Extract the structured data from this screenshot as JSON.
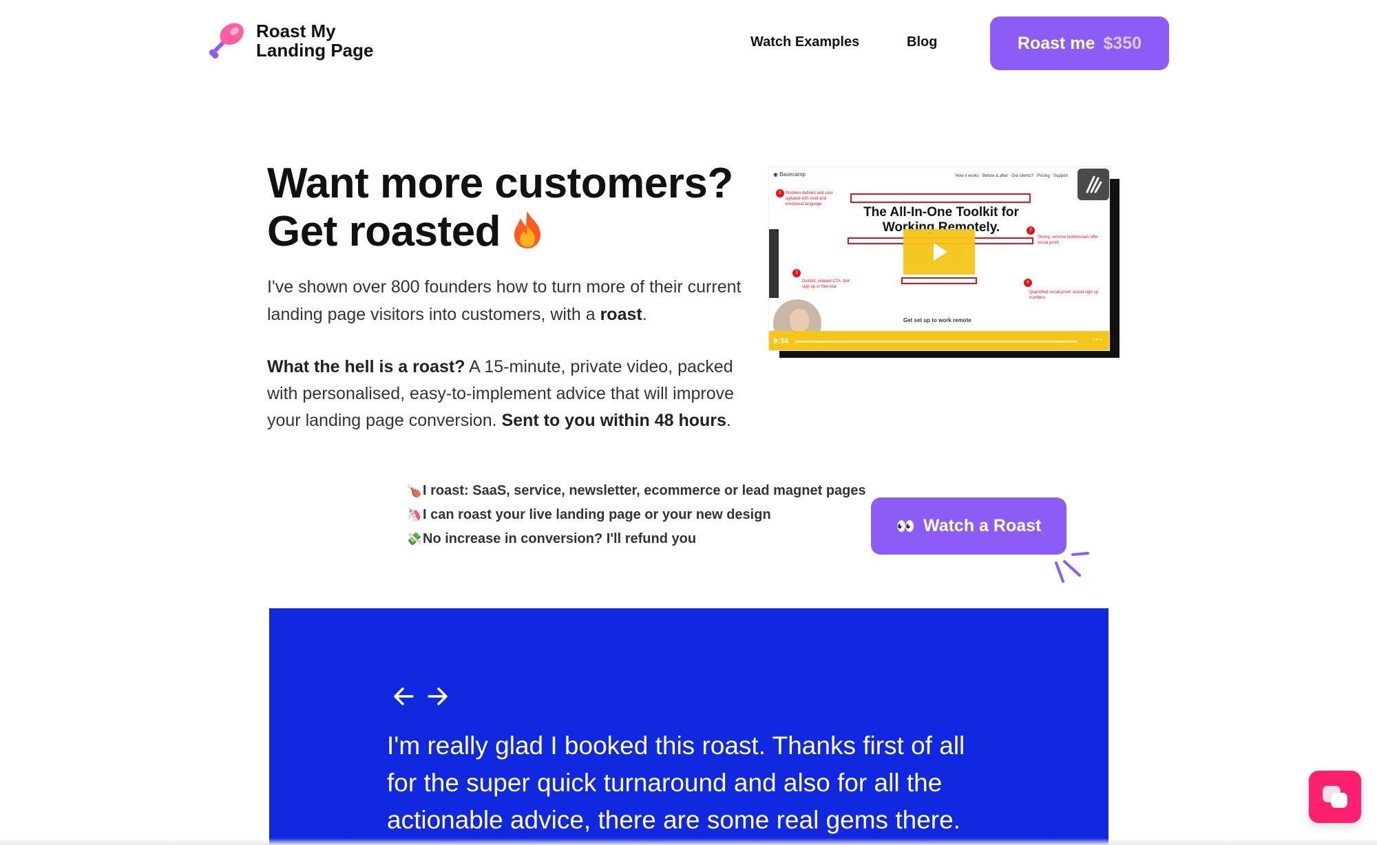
{
  "header": {
    "logo_line1": "Roast My",
    "logo_line2": "Landing Page",
    "nav": {
      "watch_examples": "Watch Examples",
      "blog": "Blog"
    },
    "cta": {
      "label": "Roast me",
      "price": "$350"
    }
  },
  "hero": {
    "title_line1": "Want more customers?",
    "title_line2": "Get roasted",
    "p1_text": "I've shown over 800 founders how to turn more of their current landing page visitors into customers, with a ",
    "p1_bold": "roast",
    "p1_end": ".",
    "p2_bold1": "What the hell is a roast?",
    "p2_text": " A 15-minute, private video, packed with personalised, easy-to-implement advice that will improve your landing page conversion. ",
    "p2_bold2": "Sent to you within 48 hours",
    "p2_end": "."
  },
  "video": {
    "brand": "Basecamp",
    "headline": "The All-In-One Toolkit for Working Remotely.",
    "time": "9:34",
    "notes": {
      "n1": "Problem defined and user agitated with vivid and emotional language",
      "n2": "Strong, concise testimonials offer social proof.",
      "n3": "Distinct, relaxed CTA. Not sign up or free trial",
      "n4": "Quantified social proof: actual sign up numbers"
    },
    "cta_text": "Get set up to work remote"
  },
  "bullets": [
    {
      "emoji": "🍗",
      "text": "I roast: SaaS, service, newsletter, ecommerce or lead magnet pages"
    },
    {
      "emoji": "🦄",
      "text": "I can roast your live landing page or your new design"
    },
    {
      "emoji": "💸",
      "text": "No increase in conversion? I'll refund you"
    }
  ],
  "watch_button": {
    "eyes": "👀",
    "label": "Watch a Roast"
  },
  "testimonial": {
    "quote": "I'm really glad I booked this roast. Thanks first of all for the super quick turnaround and also for all the actionable advice, there are some real gems there."
  },
  "colors": {
    "purple": "#8b5cf6",
    "blue": "#1028e0",
    "chat_pink": "#ff1f6e",
    "video_yellow": "#f5c518"
  }
}
